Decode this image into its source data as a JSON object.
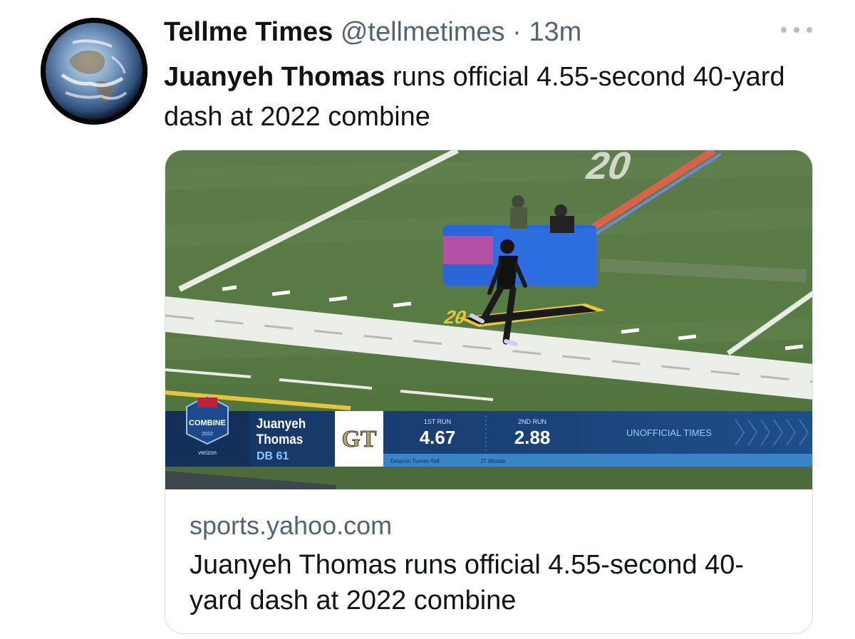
{
  "tweet": {
    "author_name": "Tellme Times",
    "handle": "@tellmetimes",
    "separator": "·",
    "time": "13m",
    "text_bold": "Juanyeh Thomas",
    "text_rest": " runs official 4.55-second 40-yard dash at 2022 combine"
  },
  "card": {
    "domain": "sports.yahoo.com",
    "title": "Juanyeh Thomas runs official 4.55-second 40-yard dash at 2022 combine",
    "media": {
      "field_number": "20",
      "marker_number": "20",
      "broadcast": {
        "event_logo": "COMBINE",
        "event_year": "2022",
        "sponsor": "verizon",
        "athlete_first": "Juanyeh",
        "athlete_last": "Thomas",
        "athlete_position": "DB 61",
        "school_logo": "GT",
        "run1_label": "1ST RUN",
        "run1_time": "4.67",
        "run2_label": "2ND RUN",
        "run2_time": "2.88",
        "note": "UNOFFICIAL TIMES",
        "ticker_1": "Deiarrin Turner-Yell",
        "ticker_2": "JT Woods"
      }
    }
  },
  "colors": {
    "text_primary": "#0f1419",
    "text_secondary": "#536471",
    "border": "#d9dee2",
    "scorebar": "#1c3f73",
    "scorebar_light": "#3a84c9"
  }
}
